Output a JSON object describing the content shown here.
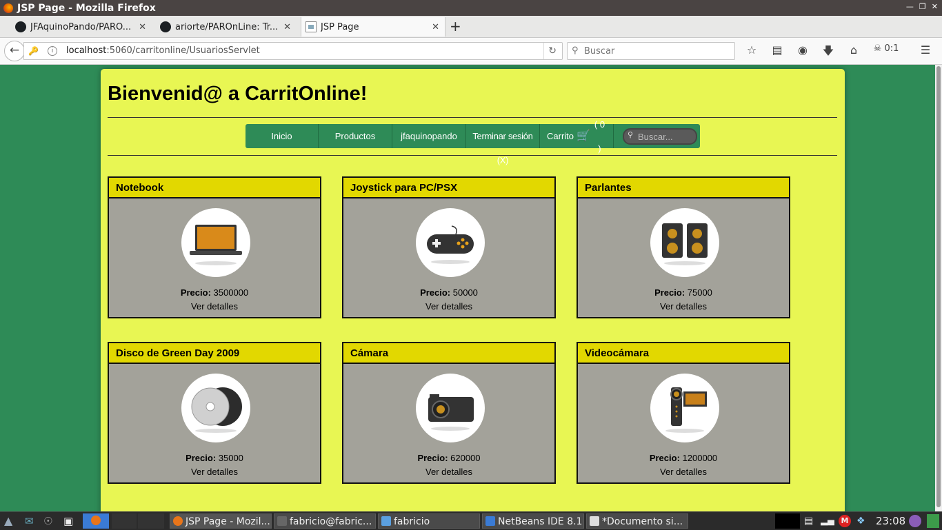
{
  "window": {
    "title": "JSP Page - Mozilla Firefox"
  },
  "tabs": [
    {
      "label": "JFAquinoPando/PARO...",
      "active": false
    },
    {
      "label": "ariorte/PAROnLine: Tr...",
      "active": false
    },
    {
      "label": "JSP Page",
      "active": true
    }
  ],
  "navbar": {
    "url_host": "localhost",
    "url_rest": ":5060/carritonline/UsuariosServlet",
    "search_placeholder": "Buscar",
    "readinglist": "0:1"
  },
  "page": {
    "heading": "Bienvenid@ a CarritOnline!",
    "menu": {
      "inicio": "Inicio",
      "productos": "Productos",
      "user": "jfaquinopando",
      "logout": "Terminar sesión (X)",
      "cart_label": "Carrito",
      "cart_count": "( 0 )",
      "search_placeholder": "Buscar..."
    },
    "price_label": "Precio:",
    "detail_label": "Ver detalles",
    "products": [
      {
        "name": "Notebook",
        "price": "3500000",
        "icon": "laptop-icon"
      },
      {
        "name": "Joystick para PC/PSX",
        "price": "50000",
        "icon": "gamepad-icon"
      },
      {
        "name": "Parlantes",
        "price": "75000",
        "icon": "speakers-icon"
      },
      {
        "name": "Disco de Green Day 2009",
        "price": "35000",
        "icon": "disc-icon"
      },
      {
        "name": "Cámara",
        "price": "620000",
        "icon": "camera-icon"
      },
      {
        "name": "Videocámara",
        "price": "1200000",
        "icon": "camcorder-icon"
      }
    ]
  },
  "taskbar": {
    "windows": [
      "JSP Page - Mozil...",
      "fabricio@fabric...",
      "fabricio",
      "NetBeans IDE 8.1",
      "*Documento si..."
    ],
    "clock": "23:08"
  },
  "colors": {
    "page_bg": "#2e8b57",
    "content_bg": "#e8f653",
    "card_header": "#e2d800",
    "card_body": "#a3a29a"
  }
}
